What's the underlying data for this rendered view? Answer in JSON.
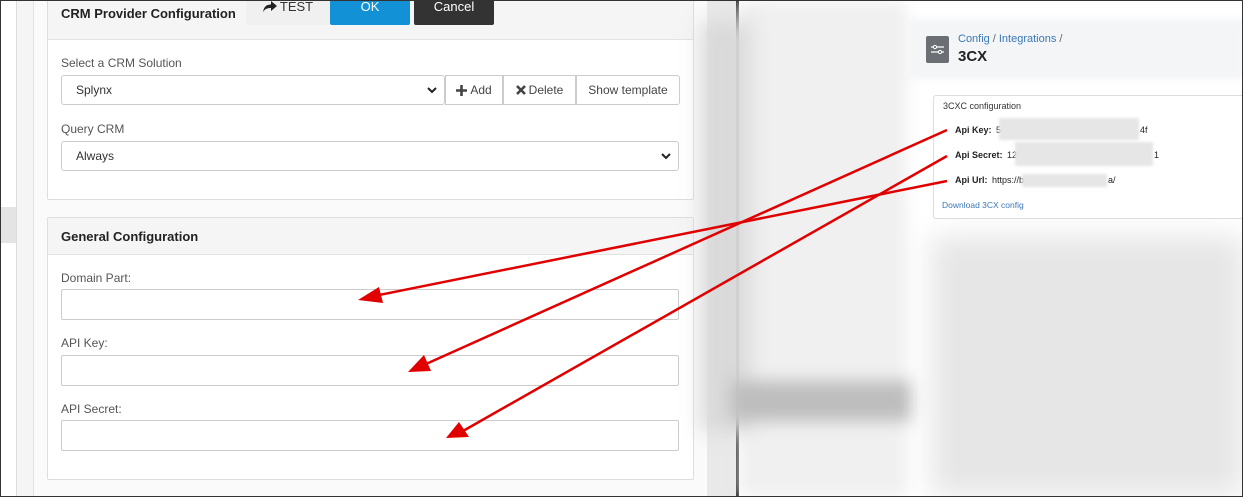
{
  "crm_panel": {
    "title": "CRM Provider Configuration",
    "test_label": "TEST",
    "ok_label": "OK",
    "cancel_label": "Cancel",
    "crm_solution_label": "Select a CRM Solution",
    "crm_solution_value": "Splynx",
    "add_label": "Add",
    "delete_label": "Delete",
    "show_template_label": "Show template",
    "query_crm_label": "Query CRM",
    "query_crm_value": "Always"
  },
  "general_panel": {
    "title": "General Configuration",
    "domain_part_label": "Domain Part:",
    "api_key_label": "API Key:",
    "api_secret_label": "API Secret:",
    "domain_part_value": "",
    "api_key_value": "",
    "api_secret_value": ""
  },
  "threecx": {
    "breadcrumb": [
      "Config",
      "Integrations"
    ],
    "title": "3CX",
    "card_title": "3CXC configuration",
    "api_key_label": "Api Key:",
    "api_key_prefix": "5",
    "api_key_suffix": "4f",
    "api_secret_label": "Api Secret:",
    "api_secret_prefix": "12",
    "api_secret_suffix": "1",
    "api_url_label": "Api Url:",
    "api_url_prefix": "https://b",
    "api_url_suffix": "a/",
    "download_link": "Download 3CX config"
  },
  "colors": {
    "ok_button": "#1291d6",
    "cancel_button": "#333333",
    "link": "#3a78b6",
    "annotation_arrow": "#e00000"
  },
  "icons": [
    "share-arrow-icon",
    "plus-icon",
    "times-icon",
    "chevron-down-icon",
    "sliders-icon"
  ]
}
